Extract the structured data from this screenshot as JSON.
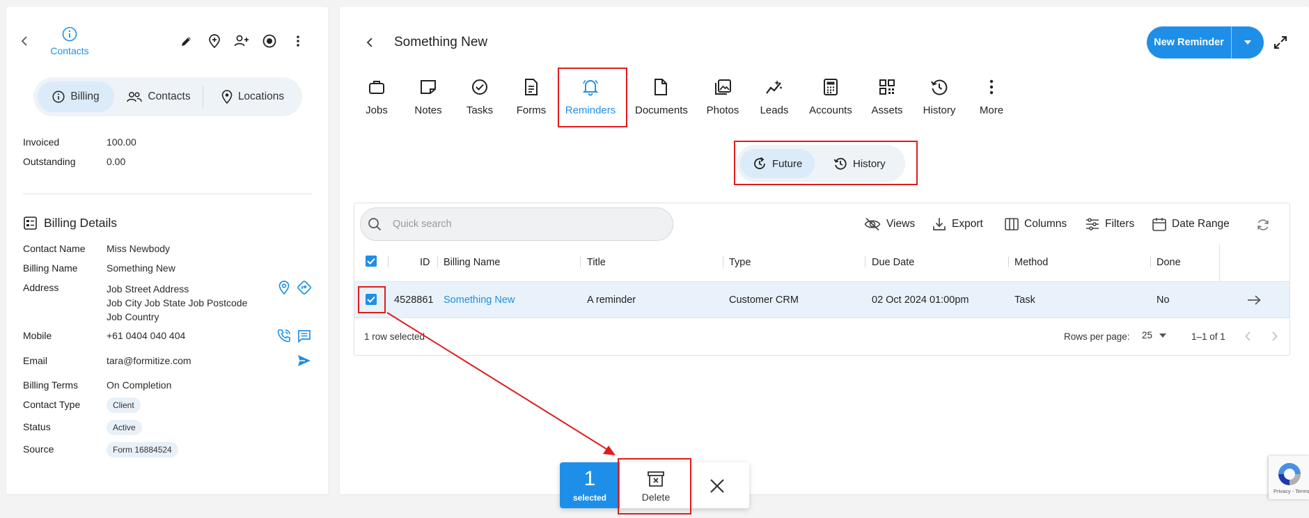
{
  "left": {
    "back_label": "",
    "contacts_label": "Contacts",
    "segments": [
      {
        "label": "Billing",
        "icon": "info-icon",
        "active": true
      },
      {
        "label": "Contacts",
        "icon": "users-icon",
        "active": false
      },
      {
        "label": "Locations",
        "icon": "location-pin-icon",
        "active": false
      }
    ],
    "summary": [
      {
        "label": "Invoiced",
        "value": "100.00"
      },
      {
        "label": "Outstanding",
        "value": "0.00"
      }
    ],
    "billing_details_title": "Billing Details",
    "details": {
      "contact_name": {
        "label": "Contact Name",
        "value": "Miss Newbody"
      },
      "billing_name": {
        "label": "Billing Name",
        "value": "Something New"
      },
      "address": {
        "label": "Address",
        "line1": "Job Street Address",
        "line2": "Job City Job State Job Postcode",
        "line3": "Job Country"
      },
      "mobile": {
        "label": "Mobile",
        "value": "+61 0404 040 404"
      },
      "email": {
        "label": "Email",
        "value": "tara@formitize.com"
      },
      "billing_terms": {
        "label": "Billing Terms",
        "value": "On Completion"
      },
      "contact_type": {
        "label": "Contact Type",
        "value": "Client"
      },
      "status": {
        "label": "Status",
        "value": "Active"
      },
      "source": {
        "label": "Source",
        "value": "Form 16884524"
      }
    }
  },
  "header": {
    "title": "Something New",
    "new_reminder_label": "New Reminder"
  },
  "tabs": [
    {
      "label": "Jobs",
      "icon": "briefcase-icon"
    },
    {
      "label": "Notes",
      "icon": "note-icon"
    },
    {
      "label": "Tasks",
      "icon": "check-circle-icon"
    },
    {
      "label": "Forms",
      "icon": "form-icon"
    },
    {
      "label": "Reminders",
      "icon": "bell-icon",
      "active": true
    },
    {
      "label": "Documents",
      "icon": "document-icon"
    },
    {
      "label": "Photos",
      "icon": "photos-icon"
    },
    {
      "label": "Leads",
      "icon": "leads-icon"
    },
    {
      "label": "Accounts",
      "icon": "calculator-icon"
    },
    {
      "label": "Assets",
      "icon": "qr-icon"
    },
    {
      "label": "History",
      "icon": "history-icon"
    },
    {
      "label": "More",
      "icon": "more-vertical-icon"
    }
  ],
  "toggle": {
    "future": "Future",
    "history": "History"
  },
  "grid": {
    "search_placeholder": "Quick search",
    "toolbar": {
      "views": "Views",
      "export": "Export",
      "columns": "Columns",
      "filters": "Filters",
      "date_range": "Date Range"
    },
    "columns": [
      "ID",
      "Billing Name",
      "Title",
      "Type",
      "Due Date",
      "Method",
      "Done"
    ],
    "rows": [
      {
        "id": "4528861",
        "billing_name": "Something New",
        "title": "A reminder",
        "type": "Customer CRM",
        "due_date": "02 Oct 2024 01:00pm",
        "method": "Task",
        "done": "No"
      }
    ],
    "footer": {
      "selected_text": "1 row selected",
      "rows_per_page_label": "Rows per page:",
      "rows_per_page_value": "25",
      "range": "1–1 of 1"
    }
  },
  "action_bar": {
    "count": "1",
    "selected_label": "selected",
    "delete_label": "Delete"
  },
  "recaptcha": {
    "text": "Privacy - Terms"
  },
  "colors": {
    "accent": "#1e8fe8",
    "annotation": "#e01b1b"
  }
}
